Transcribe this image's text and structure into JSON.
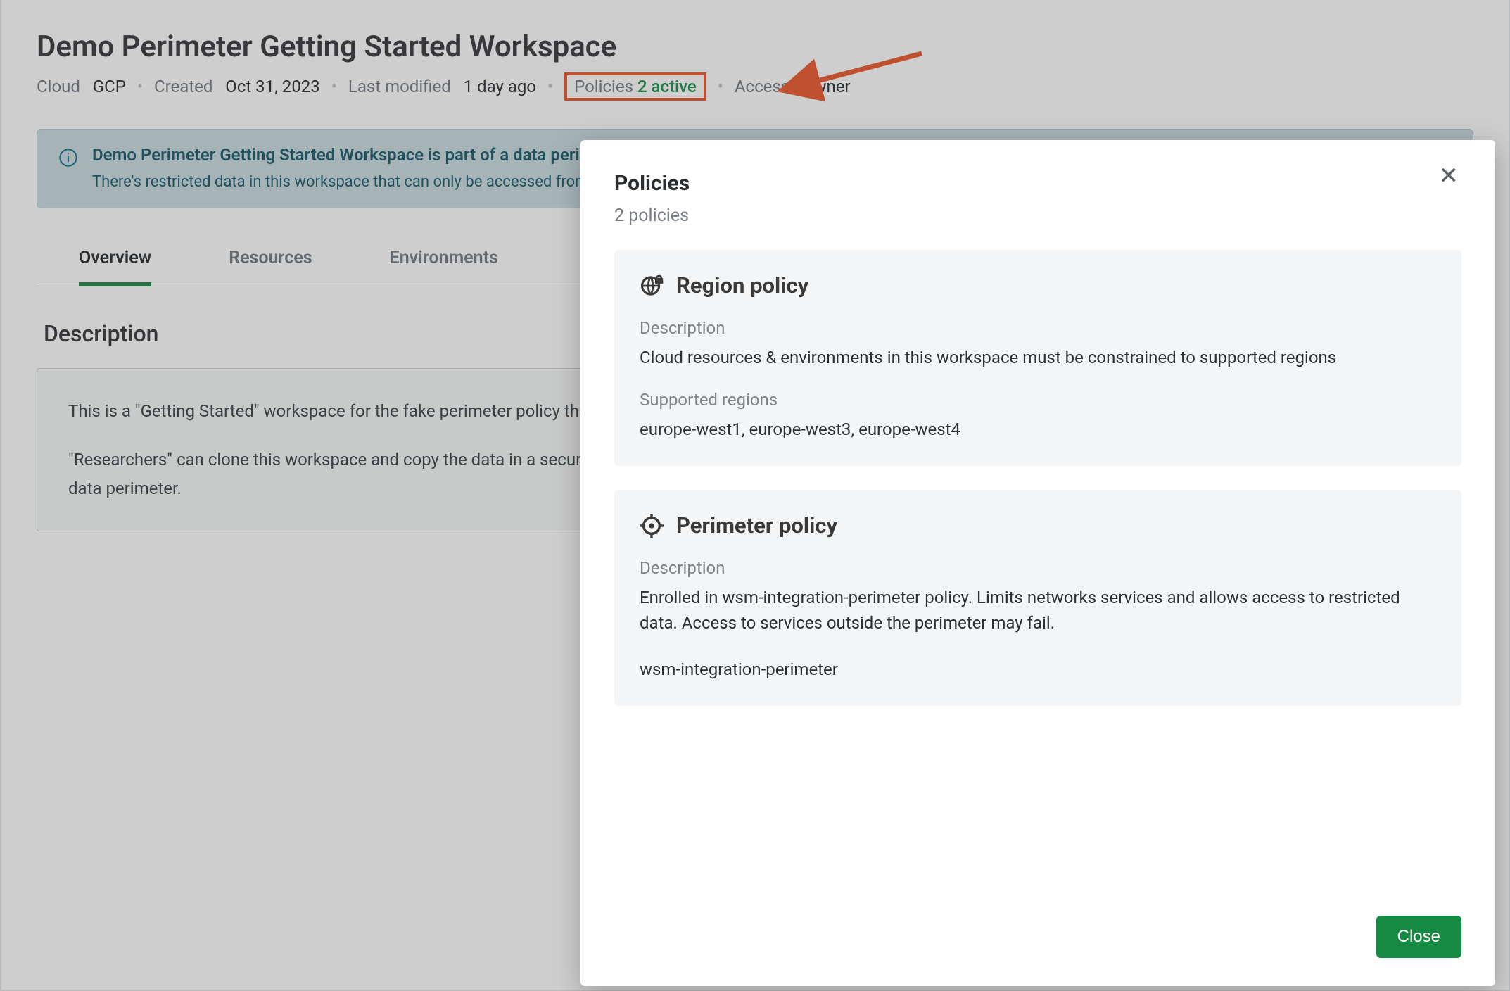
{
  "header": {
    "title": "Demo Perimeter Getting Started Workspace",
    "meta": {
      "cloud_label": "Cloud",
      "cloud_value": "GCP",
      "created_label": "Created",
      "created_value": "Oct 31, 2023",
      "modified_label": "Last modified",
      "modified_value": "1 day ago",
      "policies_label": "Policies",
      "policies_value": "2 active",
      "access_label": "Access",
      "access_value": "Owner"
    }
  },
  "alert": {
    "title": "Demo Perimeter Getting Started Workspace is part of a data perimeter",
    "desc": "There's restricted data in this workspace that can only be accessed from within the perimeter."
  },
  "tabs": {
    "items": [
      {
        "label": "Overview",
        "active": true
      },
      {
        "label": "Resources",
        "active": false
      },
      {
        "label": "Environments",
        "active": false
      }
    ]
  },
  "description": {
    "heading": "Description",
    "p1": "This is a \"Getting Started\" workspace for the fake perimeter policy that was set up to test this feature in the wsm-integration devel perimeter.",
    "p2": "\"Researchers\" can clone this workspace and copy the data in a secure manner, since the workspace has a perimeter, the cloned workspace will automatically be enrolled in the same data perimeter."
  },
  "modal": {
    "title": "Policies",
    "subtitle": "2 policies",
    "close_label": "Close",
    "policies": [
      {
        "icon": "globe-lock",
        "title": "Region policy",
        "fields": [
          {
            "label": "Description",
            "value": "Cloud resources & environments in this workspace must be constrained to supported regions"
          },
          {
            "label": "Supported regions",
            "value": "europe-west1, europe-west3, europe-west4"
          }
        ]
      },
      {
        "icon": "perimeter",
        "title": "Perimeter policy",
        "fields": [
          {
            "label": "Description",
            "value": "Enrolled in wsm-integration-perimeter policy. Limits networks services and allows access to restricted data. Access to services outside the perimeter may fail."
          },
          {
            "label": "",
            "value": "wsm-integration-perimeter"
          }
        ]
      }
    ]
  },
  "annotation": {
    "color": "#ec5224"
  }
}
